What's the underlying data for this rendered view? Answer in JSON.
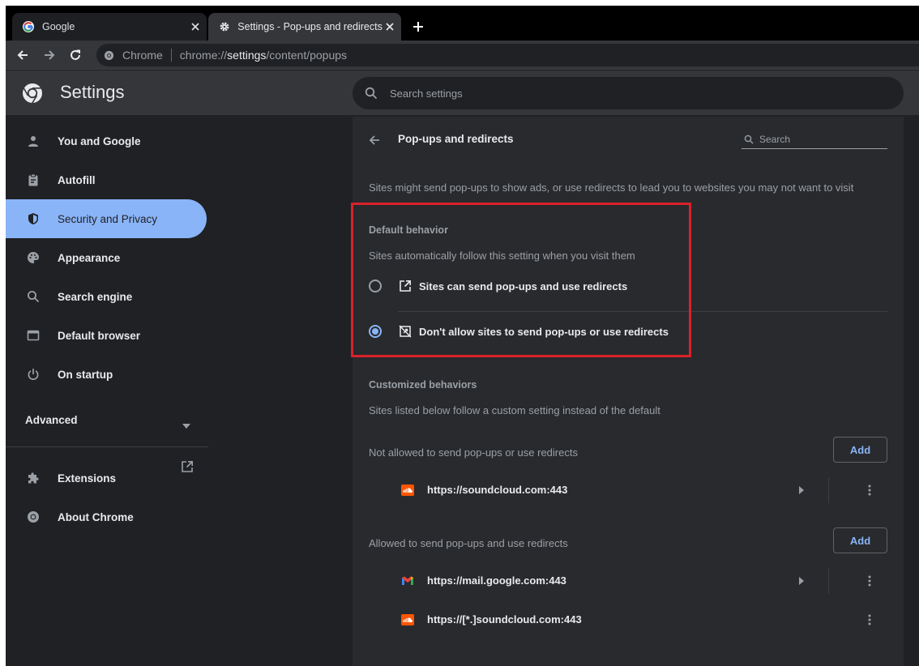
{
  "tabs": [
    {
      "title": "Google",
      "icon": "google-g-icon"
    },
    {
      "title": "Settings - Pop-ups and redirects",
      "icon": "gear-icon"
    }
  ],
  "omnibox": {
    "chip": "Chrome",
    "url_prefix": "chrome://",
    "url_bold": "settings",
    "url_suffix": "/content/popups"
  },
  "header": {
    "title": "Settings",
    "search_placeholder": "Search settings"
  },
  "sidebar": {
    "items": [
      {
        "label": "You and Google",
        "icon": "person-icon"
      },
      {
        "label": "Autofill",
        "icon": "clipboard-icon"
      },
      {
        "label": "Security and Privacy",
        "icon": "shield-icon",
        "selected": true
      },
      {
        "label": "Appearance",
        "icon": "palette-icon"
      },
      {
        "label": "Search engine",
        "icon": "search-icon"
      },
      {
        "label": "Default browser",
        "icon": "browser-window-icon"
      },
      {
        "label": "On startup",
        "icon": "power-icon"
      }
    ],
    "advanced": "Advanced",
    "extensions": "Extensions",
    "about": "About Chrome"
  },
  "page": {
    "title": "Pop-ups and redirects",
    "search_placeholder": "Search",
    "description": "Sites might send pop-ups to show ads, or use redirects to lead you to websites you may not want to visit",
    "default_behavior": {
      "title": "Default behavior",
      "subtitle": "Sites automatically follow this setting when you visit them",
      "options": [
        {
          "label": "Sites can send pop-ups and use redirects",
          "checked": false,
          "icon": "open-in-new-icon"
        },
        {
          "label": "Don't allow sites to send pop-ups or use redirects",
          "checked": true,
          "icon": "blocked-popup-icon"
        }
      ]
    },
    "customized": {
      "title": "Customized behaviors",
      "subtitle": "Sites listed below follow a custom setting instead of the default",
      "blocked": {
        "header": "Not allowed to send pop-ups or use redirects",
        "add_label": "Add",
        "sites": [
          {
            "url": "https://soundcloud.com:443",
            "favicon": "soundcloud-icon",
            "has_arrow": true
          }
        ]
      },
      "allowed": {
        "header": "Allowed to send pop-ups and use redirects",
        "add_label": "Add",
        "sites": [
          {
            "url": "https://mail.google.com:443",
            "favicon": "gmail-icon",
            "has_arrow": true
          },
          {
            "url": "https://[*.]soundcloud.com:443",
            "favicon": "soundcloud-icon",
            "has_arrow": false
          }
        ]
      }
    }
  },
  "colors": {
    "accent": "#8ab4f8",
    "background": "#202124",
    "card": "#292a2d",
    "highlight_box": "#d9222a"
  }
}
